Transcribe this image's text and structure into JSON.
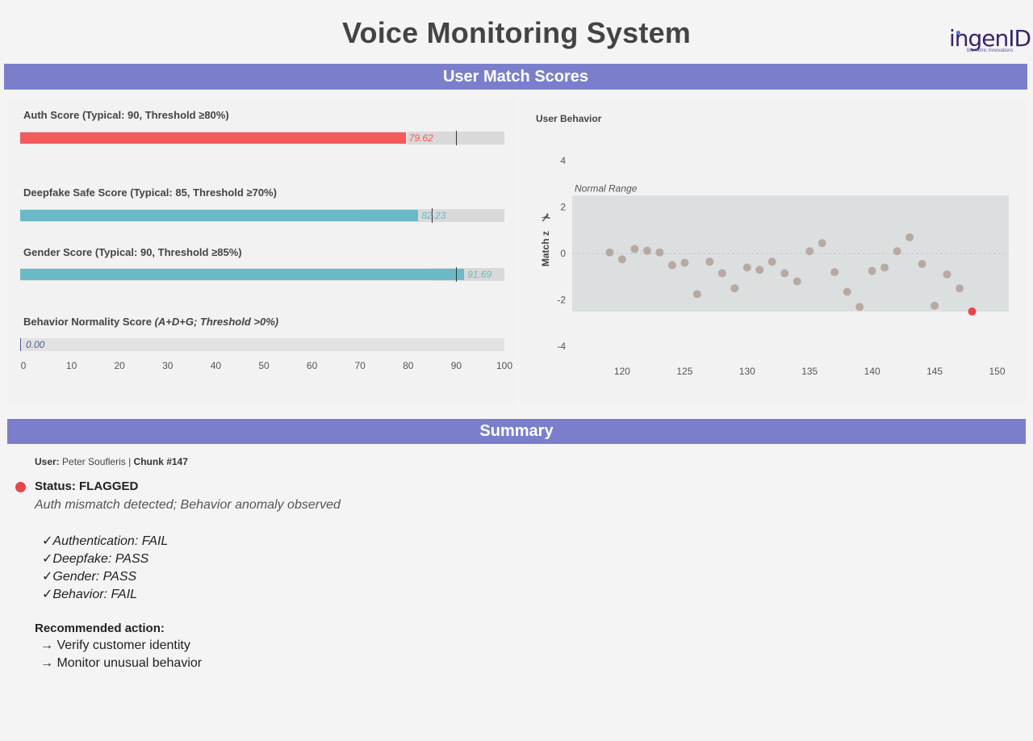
{
  "header": {
    "title": "Voice Monitoring System",
    "logo_text": "ingenID",
    "logo_subtitle": "Biometric Innovations"
  },
  "sections": {
    "scores_title": "User Match Scores",
    "summary_title": "Summary"
  },
  "scores": [
    {
      "label": "Auth Score (Typical: 90, Threshold ≥80%)",
      "value": 79.62,
      "value_text": "79.62",
      "typical": 90,
      "threshold": 80,
      "color": "#f25b5b"
    },
    {
      "label": "Deepfake Safe Score (Typical: 85, Threshold ≥70%)",
      "value": 82.23,
      "value_text": "82.23",
      "typical": 85,
      "threshold": 70,
      "color": "#69bac6"
    },
    {
      "label": "Gender Score (Typical: 90, Threshold ≥85%)",
      "value": 91.69,
      "value_text": "91.69",
      "typical": 90,
      "threshold": 85,
      "color": "#69bac6"
    },
    {
      "label": "Behavior Normality Score",
      "label_italic": "(A+D+G; Threshold >0%)",
      "value": 0.0,
      "value_text": "0.00",
      "color": "#4a5b8c"
    }
  ],
  "score_axis": {
    "ticks": [
      "0",
      "10",
      "20",
      "30",
      "40",
      "50",
      "60",
      "70",
      "80",
      "90",
      "100"
    ]
  },
  "chart_data": {
    "type": "scatter",
    "title": "User Behavior",
    "ylabel": "Match z",
    "band_label": "Normal Range",
    "band": [
      -2.5,
      2.5
    ],
    "xlim": [
      116,
      151
    ],
    "ylim": [
      -4.8,
      4.6
    ],
    "x_ticks": [
      "120",
      "125",
      "130",
      "135",
      "140",
      "145",
      "150"
    ],
    "y_ticks": [
      "4",
      "2",
      "0",
      "-2",
      "-4"
    ],
    "colors": {
      "point": "#b8a9a3",
      "highlight": "#e8474a",
      "band": "#dcdfdf"
    },
    "points": [
      {
        "x": 119,
        "y": 0.05
      },
      {
        "x": 120,
        "y": -0.25
      },
      {
        "x": 121,
        "y": 0.2
      },
      {
        "x": 122,
        "y": 0.12
      },
      {
        "x": 123,
        "y": 0.05
      },
      {
        "x": 124,
        "y": -0.5
      },
      {
        "x": 125,
        "y": -0.4
      },
      {
        "x": 126,
        "y": -1.75
      },
      {
        "x": 127,
        "y": -0.35
      },
      {
        "x": 128,
        "y": -0.85
      },
      {
        "x": 129,
        "y": -1.5
      },
      {
        "x": 130,
        "y": -0.6
      },
      {
        "x": 131,
        "y": -0.7
      },
      {
        "x": 132,
        "y": -0.35
      },
      {
        "x": 133,
        "y": -0.85
      },
      {
        "x": 134,
        "y": -1.2
      },
      {
        "x": 135,
        "y": 0.1
      },
      {
        "x": 136,
        "y": 0.45
      },
      {
        "x": 137,
        "y": -0.8
      },
      {
        "x": 138,
        "y": -1.65
      },
      {
        "x": 139,
        "y": -2.3
      },
      {
        "x": 140,
        "y": -0.75
      },
      {
        "x": 141,
        "y": -0.6
      },
      {
        "x": 142,
        "y": 0.1
      },
      {
        "x": 143,
        "y": 0.7
      },
      {
        "x": 144,
        "y": -0.45
      },
      {
        "x": 145,
        "y": -2.25
      },
      {
        "x": 146,
        "y": -0.9
      },
      {
        "x": 147,
        "y": -1.5
      },
      {
        "x": 148,
        "y": -2.5,
        "highlight": true
      }
    ]
  },
  "summary": {
    "user_label": "User:",
    "user_name": "Peter Soufleris",
    "separator": "|",
    "chunk_label": "Chunk #147",
    "status": "Status: FLAGGED",
    "status_detail": "Auth mismatch detected; Behavior anomaly observed",
    "checks": [
      "✓Authentication:  FAIL",
      "✓Deepfake: PASS",
      "✓Gender: PASS",
      "✓Behavior: FAIL"
    ],
    "recommended_title": "Recommended action:",
    "recommended": [
      "→ Verify customer identity",
      "→ Monitor unusual behavior"
    ]
  }
}
